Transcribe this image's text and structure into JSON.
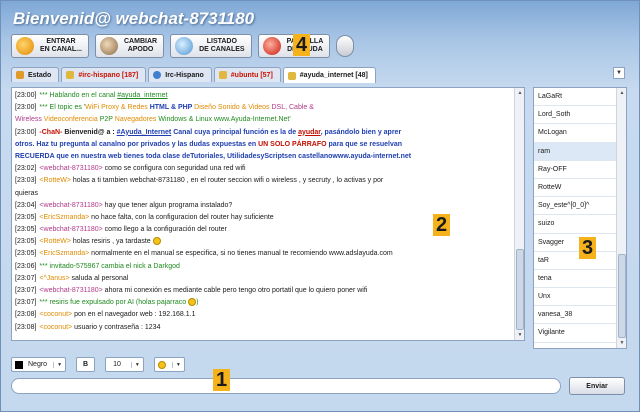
{
  "window": {
    "title": "Bienvenid@ webchat-8731180"
  },
  "toolbar": {
    "buttons": [
      {
        "label": "ENTRAR\nEN CANAL...",
        "icon": "enter-channel-icon"
      },
      {
        "label": "CAMBIAR\nAPODO",
        "icon": "users-icon"
      },
      {
        "label": "LISTADO\nDE CANALES",
        "icon": "magnifier-icon"
      },
      {
        "label": "PANTALLA\nDE AYUDA",
        "icon": "help-icon"
      }
    ],
    "extra_icon": "round-button-icon"
  },
  "callouts": {
    "c1": "1",
    "c2": "2",
    "c3": "3",
    "c4": "4"
  },
  "tabs": [
    {
      "label": "Estado",
      "icon": "home-icon"
    },
    {
      "label": "#irc-hispano [187]",
      "icon": "channel-icon",
      "highlight": true
    },
    {
      "label": "Irc-Hispano",
      "icon": "server-icon"
    },
    {
      "label": "#ubuntu [57]",
      "icon": "channel-icon",
      "highlight": true
    },
    {
      "label": "#ayuda_internet [48]",
      "icon": "channel-icon",
      "active": true
    }
  ],
  "chat": {
    "lines": [
      [
        [
          "[23:00]",
          "t"
        ],
        [
          "*** Hablando en el canal ",
          "g"
        ],
        [
          "#ayuda_internet",
          "g u"
        ]
      ],
      [
        [
          "[23:00]",
          "t"
        ],
        [
          "*** El topic es '",
          "g"
        ],
        [
          "WiFi",
          "o"
        ],
        [
          " Proxy & Redes ",
          "o"
        ],
        [
          "HTML & PHP ",
          "b"
        ],
        [
          "Diseño Sonido & Videos ",
          "o"
        ],
        [
          "DSL, Cable &",
          "n"
        ]
      ],
      [
        [
          "Wireless ",
          "n"
        ],
        [
          "Videoconferencia ",
          "o"
        ],
        [
          "P2P ",
          "g"
        ],
        [
          "Navegadores ",
          "o"
        ],
        [
          "     Windows & Linux ",
          "g"
        ],
        [
          "www.Ayuda-Internet.Net",
          "g"
        ],
        [
          "'",
          "g"
        ]
      ],
      [
        [
          "[23:00]",
          "t"
        ],
        [
          "-ChaN- ",
          "r"
        ],
        [
          " Bienvenid@ a : ",
          "k"
        ],
        [
          "#Ayuda_Internet",
          "b u"
        ],
        [
          " Canal cuya principal función es la de ",
          "b"
        ],
        [
          "ayudar",
          "r u"
        ],
        [
          ", pasándolo bien y aprer",
          "b"
        ]
      ],
      [
        [
          "otros. Haz tu pregunta al canalno por privados  y las dudas expuestas en ",
          "b"
        ],
        [
          "UN SOLO PÁRRAFO",
          "r"
        ],
        [
          " para que se resuelvan",
          "b"
        ]
      ],
      [
        [
          " RECUERDA  que en nuestra web tienes toda clase deTutoriales, UtilidadesyScriptsen castellanowww.ayuda-internet.net",
          "b"
        ]
      ],
      [
        [
          "[23:02]",
          "t"
        ],
        [
          "<webchat-8731180>",
          "n"
        ],
        [
          "  como se configura con seguridad una red wifi",
          ""
        ]
      ],
      [
        [
          "[23:03]",
          "t"
        ],
        [
          "<RotteW>",
          "o"
        ],
        [
          "  holas a ti tambien webchat-8731180 , en el router seccion wifi o wireless , y secruty , lo activas y por",
          ""
        ]
      ],
      [
        [
          "quieras",
          ""
        ]
      ],
      [
        [
          "[23:04]",
          "t"
        ],
        [
          "<webchat-8731180>",
          "n"
        ],
        [
          "  hay que tener algun programa instalado?",
          ""
        ]
      ],
      [
        [
          "[23:05]",
          "t"
        ],
        [
          "<EricSzmanda>",
          "o"
        ],
        [
          "  no hace falta, con la configuracion del router hay suficiente",
          ""
        ]
      ],
      [
        [
          "[23:05]",
          "t"
        ],
        [
          "<webchat-8731180>",
          "n"
        ],
        [
          "  como llego a la configuración del router",
          ""
        ]
      ],
      [
        [
          "[23:05]",
          "t"
        ],
        [
          "<RotteW>",
          "o"
        ],
        [
          "  holas resiris , ya tardaste ",
          ""
        ],
        [
          ":)",
          "smile"
        ]
      ],
      [
        [
          "[23:05]",
          "t"
        ],
        [
          "<EricSzmanda>",
          "o"
        ],
        [
          "  normalmente en el manual se especifica, si no tienes manual te recomiendo www.adslayuda.com",
          ""
        ]
      ],
      [
        [
          "[23:06]",
          "t"
        ],
        [
          "*** invitado-575967 cambia el nick a Darkgod",
          "g"
        ]
      ],
      [
        [
          "[23:07]",
          "t"
        ],
        [
          "<^Janus>",
          "o"
        ],
        [
          "  saluda al personal",
          ""
        ]
      ],
      [
        [
          "[23:07]",
          "t"
        ],
        [
          "<webchat-8731180>",
          "n"
        ],
        [
          "  ahora mi conexión es mediante cable pero tengo otro portatil que lo quiero poner wifi",
          ""
        ]
      ],
      [
        [
          "[23:07]",
          "t"
        ],
        [
          "*** resiris fue expulsado por AI (holas pajarraco ",
          "g"
        ],
        [
          ":)",
          "smile"
        ],
        [
          ")",
          "g"
        ]
      ],
      [
        [
          "[23:08]",
          "t"
        ],
        [
          "<coconut>",
          "o"
        ],
        [
          "  pon en el navegador web :    192.168.1.1",
          ""
        ]
      ],
      [
        [
          "[23:08]",
          "t"
        ],
        [
          "<coconut>",
          "o"
        ],
        [
          "  usuario y contraseña : 1234",
          ""
        ]
      ]
    ],
    "scroll_fraction": 1.0
  },
  "users": {
    "items": [
      "LaGaRt",
      "Lord_Soth",
      "McLogan",
      "ram",
      "Ray-OFF",
      "RotteW",
      "Soy_este^[0_0]^",
      "suizo",
      "Svagger",
      "taR",
      "tena",
      "Unx",
      "vanesa_38",
      "Vigilante",
      "War",
      "webchat-8731180"
    ],
    "selected_index": 3,
    "scroll_fraction": 1.0
  },
  "format_bar": {
    "color_label": "Negro",
    "color_value": "#000000",
    "bold_label": "B",
    "size_value": "10",
    "emoji_icon": "smiley-icon"
  },
  "input": {
    "value": "",
    "placeholder": ""
  },
  "send_label": "Enviar",
  "colors": {
    "accent": "#f5b21b",
    "nick_self": "#b03a8a",
    "nick_other": "#e08a00",
    "system": "#1f8a1f"
  }
}
